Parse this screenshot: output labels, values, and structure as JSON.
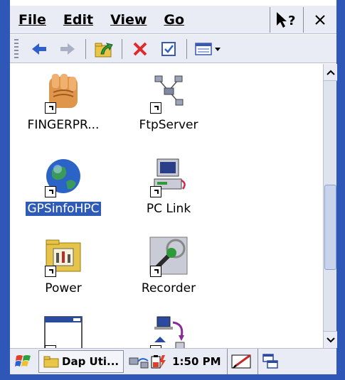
{
  "menu": {
    "file": "File",
    "edit": "Edit",
    "view": "View",
    "go": "Go"
  },
  "icons": [
    {
      "label": "FINGERPR...",
      "icon": "fingerprint-hand-icon"
    },
    {
      "label": "FtpServer",
      "icon": "network-icon"
    },
    {
      "label": "GPSinfoHPC",
      "icon": "globe-icon",
      "selected": true
    },
    {
      "label": "PC Link",
      "icon": "pc-link-icon"
    },
    {
      "label": "Power",
      "icon": "control-panel-folder-icon"
    },
    {
      "label": "Recorder",
      "icon": "microphone-icon"
    },
    {
      "label": "",
      "icon": "window-icon"
    },
    {
      "label": "",
      "icon": "sync-icon"
    }
  ],
  "taskbar": {
    "task_label": "Dap Uti...",
    "time": "1:50 PM"
  },
  "colors": {
    "frame": "#2f57b8",
    "bar": "#e9ecf5",
    "selection": "#2f5bb8"
  }
}
